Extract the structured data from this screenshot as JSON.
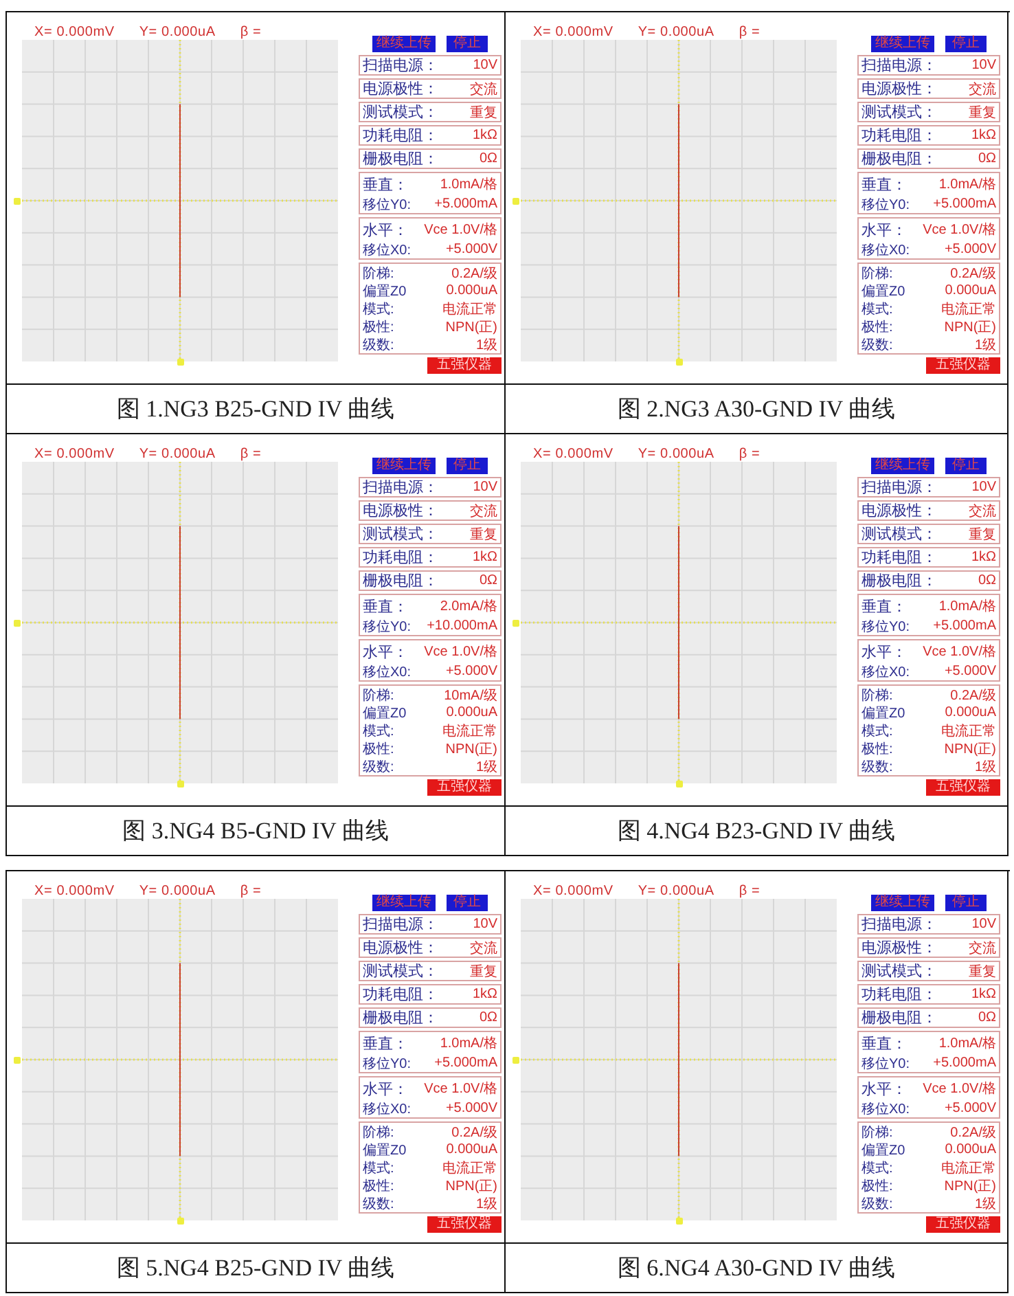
{
  "tables": [
    {
      "rows": [
        {
          "figures": [
            {
              "readout": [
                "X= 0.000mV",
                "Y= 0.000uA",
                "β ="
              ],
              "buttons": [
                "继续上传",
                "停止"
              ],
              "settings": [
                {
                  "label": "扫描电源：",
                  "value": "10V"
                },
                {
                  "label": "电源极性：",
                  "value": "交流"
                },
                {
                  "label": "测试模式：",
                  "value": "重复"
                },
                {
                  "label": "功耗电阻：",
                  "value": "1kΩ"
                },
                {
                  "label": "栅极电阻：",
                  "value": "0Ω"
                }
              ],
              "groups": [
                {
                  "lines": [
                    {
                      "kind": "main",
                      "label": "垂直：",
                      "value": "1.0mA/格"
                    },
                    {
                      "kind": "sub",
                      "label": "移位Y0:",
                      "value": "+5.000mA"
                    }
                  ]
                },
                {
                  "lines": [
                    {
                      "kind": "main",
                      "label": "水平：",
                      "value": "Vce 1.0V/格"
                    },
                    {
                      "kind": "sub",
                      "label": "移位X0:",
                      "value": "+5.000V"
                    }
                  ]
                },
                {
                  "lines": [
                    {
                      "kind": "sub",
                      "label": "阶梯:",
                      "value": "0.2A/级"
                    },
                    {
                      "kind": "sub",
                      "label": "偏置Z0",
                      "value": "0.000uA"
                    },
                    {
                      "kind": "sub",
                      "label": "模式:",
                      "value": "电流正常"
                    },
                    {
                      "kind": "sub",
                      "label": "极性:",
                      "value": "NPN(正)"
                    },
                    {
                      "kind": "sub",
                      "label": "级数:",
                      "value": "1级"
                    }
                  ]
                }
              ],
              "brand": "五强仪器",
              "caption": "图 1.NG3 B25-GND IV 曲线"
            },
            {
              "readout": [
                "X= 0.000mV",
                "Y= 0.000uA",
                "β ="
              ],
              "buttons": [
                "继续上传",
                "停止"
              ],
              "settings": [
                {
                  "label": "扫描电源：",
                  "value": "10V"
                },
                {
                  "label": "电源极性：",
                  "value": "交流"
                },
                {
                  "label": "测试模式：",
                  "value": "重复"
                },
                {
                  "label": "功耗电阻：",
                  "value": "1kΩ"
                },
                {
                  "label": "栅极电阻：",
                  "value": "0Ω"
                }
              ],
              "groups": [
                {
                  "lines": [
                    {
                      "kind": "main",
                      "label": "垂直：",
                      "value": "1.0mA/格"
                    },
                    {
                      "kind": "sub",
                      "label": "移位Y0:",
                      "value": "+5.000mA"
                    }
                  ]
                },
                {
                  "lines": [
                    {
                      "kind": "main",
                      "label": "水平：",
                      "value": "Vce 1.0V/格"
                    },
                    {
                      "kind": "sub",
                      "label": "移位X0:",
                      "value": "+5.000V"
                    }
                  ]
                },
                {
                  "lines": [
                    {
                      "kind": "sub",
                      "label": "阶梯:",
                      "value": "0.2A/级"
                    },
                    {
                      "kind": "sub",
                      "label": "偏置Z0",
                      "value": "0.000uA"
                    },
                    {
                      "kind": "sub",
                      "label": "模式:",
                      "value": "电流正常"
                    },
                    {
                      "kind": "sub",
                      "label": "极性:",
                      "value": "NPN(正)"
                    },
                    {
                      "kind": "sub",
                      "label": "级数:",
                      "value": "1级"
                    }
                  ]
                }
              ],
              "brand": "五强仪器",
              "caption": "图 2.NG3 A30-GND IV 曲线"
            }
          ]
        },
        {
          "figures": [
            {
              "readout": [
                "X= 0.000mV",
                "Y= 0.000uA",
                "β ="
              ],
              "buttons": [
                "继续上传",
                "停止"
              ],
              "settings": [
                {
                  "label": "扫描电源：",
                  "value": "10V"
                },
                {
                  "label": "电源极性：",
                  "value": "交流"
                },
                {
                  "label": "测试模式：",
                  "value": "重复"
                },
                {
                  "label": "功耗电阻：",
                  "value": "1kΩ"
                },
                {
                  "label": "栅极电阻：",
                  "value": "0Ω"
                }
              ],
              "groups": [
                {
                  "lines": [
                    {
                      "kind": "main",
                      "label": "垂直：",
                      "value": "2.0mA/格"
                    },
                    {
                      "kind": "sub",
                      "label": "移位Y0:",
                      "value": "+10.000mA"
                    }
                  ]
                },
                {
                  "lines": [
                    {
                      "kind": "main",
                      "label": "水平：",
                      "value": "Vce 1.0V/格"
                    },
                    {
                      "kind": "sub",
                      "label": "移位X0:",
                      "value": "+5.000V"
                    }
                  ]
                },
                {
                  "lines": [
                    {
                      "kind": "sub",
                      "label": "阶梯:",
                      "value": "10mA/级"
                    },
                    {
                      "kind": "sub",
                      "label": "偏置Z0",
                      "value": "0.000uA"
                    },
                    {
                      "kind": "sub",
                      "label": "模式:",
                      "value": "电流正常"
                    },
                    {
                      "kind": "sub",
                      "label": "极性:",
                      "value": "NPN(正)"
                    },
                    {
                      "kind": "sub",
                      "label": "级数:",
                      "value": "1级"
                    }
                  ]
                }
              ],
              "brand": "五强仪器",
              "caption": "图 3.NG4 B5-GND IV 曲线"
            },
            {
              "readout": [
                "X= 0.000mV",
                "Y= 0.000uA",
                "β ="
              ],
              "buttons": [
                "继续上传",
                "停止"
              ],
              "settings": [
                {
                  "label": "扫描电源：",
                  "value": "10V"
                },
                {
                  "label": "电源极性：",
                  "value": "交流"
                },
                {
                  "label": "测试模式：",
                  "value": "重复"
                },
                {
                  "label": "功耗电阻：",
                  "value": "1kΩ"
                },
                {
                  "label": "栅极电阻：",
                  "value": "0Ω"
                }
              ],
              "groups": [
                {
                  "lines": [
                    {
                      "kind": "main",
                      "label": "垂直：",
                      "value": "1.0mA/格"
                    },
                    {
                      "kind": "sub",
                      "label": "移位Y0:",
                      "value": "+5.000mA"
                    }
                  ]
                },
                {
                  "lines": [
                    {
                      "kind": "main",
                      "label": "水平：",
                      "value": "Vce 1.0V/格"
                    },
                    {
                      "kind": "sub",
                      "label": "移位X0:",
                      "value": "+5.000V"
                    }
                  ]
                },
                {
                  "lines": [
                    {
                      "kind": "sub",
                      "label": "阶梯:",
                      "value": "0.2A/级"
                    },
                    {
                      "kind": "sub",
                      "label": "偏置Z0",
                      "value": "0.000uA"
                    },
                    {
                      "kind": "sub",
                      "label": "模式:",
                      "value": "电流正常"
                    },
                    {
                      "kind": "sub",
                      "label": "极性:",
                      "value": "NPN(正)"
                    },
                    {
                      "kind": "sub",
                      "label": "级数:",
                      "value": "1级"
                    }
                  ]
                }
              ],
              "brand": "五强仪器",
              "caption": "图 4.NG4 B23-GND IV 曲线"
            }
          ]
        }
      ]
    },
    {
      "rows": [
        {
          "figures": [
            {
              "readout": [
                "X= 0.000mV",
                "Y= 0.000uA",
                "β ="
              ],
              "buttons": [
                "继续上传",
                "停止"
              ],
              "settings": [
                {
                  "label": "扫描电源：",
                  "value": "10V"
                },
                {
                  "label": "电源极性：",
                  "value": "交流"
                },
                {
                  "label": "测试模式：",
                  "value": "重复"
                },
                {
                  "label": "功耗电阻：",
                  "value": "1kΩ"
                },
                {
                  "label": "栅极电阻：",
                  "value": "0Ω"
                }
              ],
              "groups": [
                {
                  "lines": [
                    {
                      "kind": "main",
                      "label": "垂直：",
                      "value": "1.0mA/格"
                    },
                    {
                      "kind": "sub",
                      "label": "移位Y0:",
                      "value": "+5.000mA"
                    }
                  ]
                },
                {
                  "lines": [
                    {
                      "kind": "main",
                      "label": "水平：",
                      "value": "Vce 1.0V/格"
                    },
                    {
                      "kind": "sub",
                      "label": "移位X0:",
                      "value": "+5.000V"
                    }
                  ]
                },
                {
                  "lines": [
                    {
                      "kind": "sub",
                      "label": "阶梯:",
                      "value": "0.2A/级"
                    },
                    {
                      "kind": "sub",
                      "label": "偏置Z0",
                      "value": "0.000uA"
                    },
                    {
                      "kind": "sub",
                      "label": "模式:",
                      "value": "电流正常"
                    },
                    {
                      "kind": "sub",
                      "label": "极性:",
                      "value": "NPN(正)"
                    },
                    {
                      "kind": "sub",
                      "label": "级数:",
                      "value": "1级"
                    }
                  ]
                }
              ],
              "brand": "五强仪器",
              "caption": "图 5.NG4 B25-GND IV 曲线"
            },
            {
              "readout": [
                "X= 0.000mV",
                "Y= 0.000uA",
                "β ="
              ],
              "buttons": [
                "继续上传",
                "停止"
              ],
              "settings": [
                {
                  "label": "扫描电源：",
                  "value": "10V"
                },
                {
                  "label": "电源极性：",
                  "value": "交流"
                },
                {
                  "label": "测试模式：",
                  "value": "重复"
                },
                {
                  "label": "功耗电阻：",
                  "value": "1kΩ"
                },
                {
                  "label": "栅极电阻：",
                  "value": "0Ω"
                }
              ],
              "groups": [
                {
                  "lines": [
                    {
                      "kind": "main",
                      "label": "垂直：",
                      "value": "1.0mA/格"
                    },
                    {
                      "kind": "sub",
                      "label": "移位Y0:",
                      "value": "+5.000mA"
                    }
                  ]
                },
                {
                  "lines": [
                    {
                      "kind": "main",
                      "label": "水平：",
                      "value": "Vce 1.0V/格"
                    },
                    {
                      "kind": "sub",
                      "label": "移位X0:",
                      "value": "+5.000V"
                    }
                  ]
                },
                {
                  "lines": [
                    {
                      "kind": "sub",
                      "label": "阶梯:",
                      "value": "0.2A/级"
                    },
                    {
                      "kind": "sub",
                      "label": "偏置Z0",
                      "value": "0.000uA"
                    },
                    {
                      "kind": "sub",
                      "label": "模式:",
                      "value": "电流正常"
                    },
                    {
                      "kind": "sub",
                      "label": "极性:",
                      "value": "NPN(正)"
                    },
                    {
                      "kind": "sub",
                      "label": "级数:",
                      "value": "1级"
                    }
                  ]
                }
              ],
              "brand": "五强仪器",
              "caption": "图 6.NG4 A30-GND IV 曲线"
            }
          ]
        }
      ]
    }
  ]
}
